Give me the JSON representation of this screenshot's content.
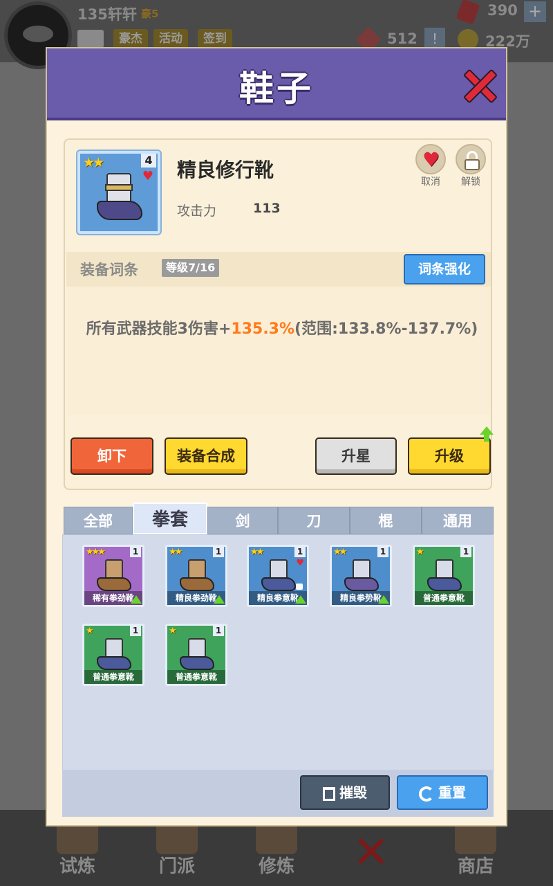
{
  "hud": {
    "player_name": "135轩轩",
    "vip": "豪5",
    "buttons": [
      "豪杰",
      "活动",
      "签到"
    ],
    "gems": "390",
    "tokens": "512",
    "coins": "222万",
    "plus": "+",
    "info": "!"
  },
  "bottom_nav": [
    "试炼",
    "门派",
    "修炼",
    "",
    "商店"
  ],
  "dialog": {
    "title": "鞋子",
    "item": {
      "name": "精良修行靴",
      "stars": "★★",
      "quantity": "4",
      "stat_label": "攻击力",
      "stat_value": "113",
      "cancel_label": "取消",
      "unlock_label": "解锁"
    },
    "attributes": {
      "title": "装备词条",
      "level": "等级7/16",
      "enhance_label": "词条强化",
      "text_prefix": "所有武器技能3伤害+",
      "text_highlight": "135.3%",
      "text_suffix": "(范围:133.8%-137.7%)"
    },
    "actions": {
      "unequip": "卸下",
      "synthesize": "装备合成",
      "star_up": "升星",
      "upgrade": "升级"
    },
    "tabs": [
      "全部",
      "拳套",
      "剑",
      "刀",
      "棍",
      "通用"
    ],
    "active_tab": "拳套",
    "inventory": [
      {
        "name": "稀有拳劲靴",
        "stars": "★★★",
        "qty": "1",
        "rarity": "purple",
        "upgradable": true
      },
      {
        "name": "精良拳劲靴",
        "stars": "★★",
        "qty": "1",
        "rarity": "blue",
        "upgradable": true
      },
      {
        "name": "精良拳意靴",
        "stars": "★★",
        "qty": "1",
        "rarity": "blue",
        "upgradable": true,
        "favorite": true,
        "locked": true
      },
      {
        "name": "精良拳势靴",
        "stars": "★★",
        "qty": "1",
        "rarity": "blue",
        "upgradable": true
      },
      {
        "name": "普通拳意靴",
        "stars": "★",
        "qty": "1",
        "rarity": "green"
      },
      {
        "name": "普通拳意靴",
        "stars": "★",
        "qty": "1",
        "rarity": "green"
      },
      {
        "name": "普通拳意靴",
        "stars": "★",
        "qty": "1",
        "rarity": "green"
      }
    ],
    "destroy_label": "摧毁",
    "reset_label": "重置"
  },
  "colors": {
    "header": "#6b5bab",
    "highlight": "#ff7a1a",
    "rarity_purple": "#a46ac8",
    "rarity_blue": "#4f8ecc",
    "rarity_green": "#3fa35b"
  }
}
